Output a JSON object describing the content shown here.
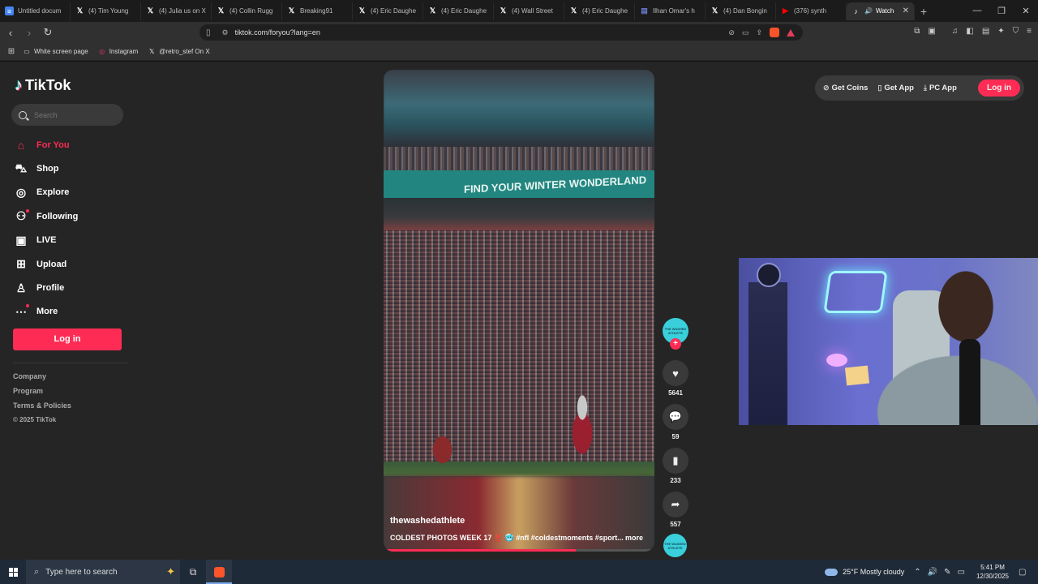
{
  "browser": {
    "tabs": [
      {
        "label": "Untitled docum",
        "icon": "docs-icon",
        "color": "#4285f4"
      },
      {
        "label": "(4) Tim Young",
        "icon": "x-icon",
        "color": "#000000"
      },
      {
        "label": "(4) Julia us on X",
        "icon": "x-icon",
        "color": "#000000"
      },
      {
        "label": "(4) Collin Rugg",
        "icon": "x-icon",
        "color": "#000000"
      },
      {
        "label": "Breaking91",
        "icon": "x-icon",
        "color": "#000000"
      },
      {
        "label": "(4) Eric Daughe",
        "icon": "x-icon",
        "color": "#000000"
      },
      {
        "label": "(4) Eric Daughe",
        "icon": "x-icon",
        "color": "#000000"
      },
      {
        "label": "(4) Wall Street",
        "icon": "x-icon",
        "color": "#000000"
      },
      {
        "label": "(4) Eric Daughe",
        "icon": "x-icon",
        "color": "#000000"
      },
      {
        "label": "Ilhan Omar's h",
        "icon": "news-icon",
        "color": "#6a7bd0"
      },
      {
        "label": "(4) Dan Bongin",
        "icon": "x-icon",
        "color": "#000000"
      },
      {
        "label": "(376) synth",
        "icon": "youtube-icon",
        "color": "#ff0000"
      }
    ],
    "active_tab": {
      "label": "Watch",
      "icon": "tiktok-icon"
    },
    "url": "tiktok.com/foryou?lang=en",
    "bookmarks": [
      {
        "label": "White screen page",
        "icon": "page-icon"
      },
      {
        "label": "Instagram",
        "icon": "instagram-icon"
      },
      {
        "label": "@retro_stef On X",
        "icon": "x-icon"
      }
    ]
  },
  "tiktok": {
    "brand": "TikTok",
    "search_placeholder": "Search",
    "nav": [
      {
        "label": "For You",
        "icon": "home-icon",
        "active": true
      },
      {
        "label": "Shop",
        "icon": "shop-icon"
      },
      {
        "label": "Explore",
        "icon": "compass-icon"
      },
      {
        "label": "Following",
        "icon": "following-icon"
      },
      {
        "label": "LIVE",
        "icon": "live-icon"
      },
      {
        "label": "Upload",
        "icon": "upload-icon"
      },
      {
        "label": "Profile",
        "icon": "profile-icon"
      },
      {
        "label": "More",
        "icon": "more-icon"
      }
    ],
    "login_label": "Log in",
    "footer": {
      "company": "Company",
      "program": "Program",
      "terms": "Terms & Policies",
      "copyright": "© 2025 TikTok"
    },
    "top_buttons": {
      "coins": "Get Coins",
      "app": "Get App",
      "pc_app": "PC App",
      "login": "Log in"
    },
    "video": {
      "banner_text": "FIND YOUR WINTER WONDERLAND",
      "username": "thewashedathlete",
      "caption": "COLDEST PHOTOS WEEK 17 ‼️ 🥶 #nfl #coldestmoments #sport...",
      "more": "more",
      "progress": 0.71
    },
    "avatar_text": "THE WASHED ATHLETE",
    "actions": {
      "likes": "5641",
      "comments": "59",
      "saves": "233",
      "shares": "557"
    },
    "accent_color": "#fe2c55"
  },
  "taskbar": {
    "search_placeholder": "Type here to search",
    "weather": "25°F  Mostly cloudy",
    "time": "5:41 PM",
    "date": "12/30/2025"
  }
}
